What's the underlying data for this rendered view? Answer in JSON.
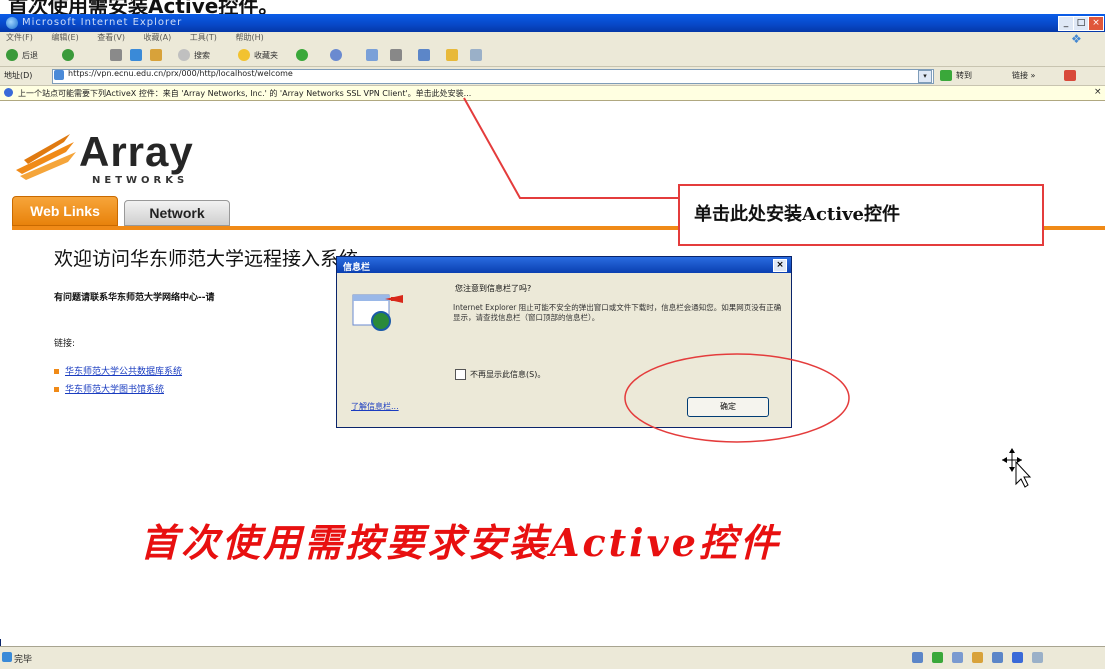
{
  "window": {
    "title": "Microsoft Internet Explorer",
    "buttons": [
      "_",
      "□",
      "×"
    ]
  },
  "address": {
    "label": "地址(D)",
    "url": "https://vpn.ecnu.edu.cn/prx/000/http/localhost/welcome"
  },
  "infobar": {
    "text": "上一个站点可能需要下列ActiveX 控件：来自 'Array Networks, Inc.' 的 'Array Networks SSL VPN Client'。单击此处安装..."
  },
  "logo": {
    "word": "Array",
    "sub": "NETWORKS"
  },
  "tabs": [
    {
      "label": "Web Links"
    },
    {
      "label": "Network"
    }
  ],
  "main": {
    "welcome": "欢迎访问华东师范大学远程接入系统",
    "contact": "有问题请联系华东师范大学网络中心--请",
    "links_label": "链接:",
    "links": [
      "华东师范大学公共数据库系统",
      "华东师范大学图书馆系统"
    ]
  },
  "callout": {
    "text": "单击此处安装Active控件"
  },
  "dialog": {
    "title": "信息栏",
    "question": "您注意到信息栏了吗?",
    "body": "Internet Explorer 阻止可能不安全的弹出窗口或文件下载时，信息栏会通知您。如果网页没有正确显示，请查找信息栏（窗口顶部的信息栏）。",
    "checkbox": "不再显示此信息(S)。",
    "learn_more": "了解信息栏...",
    "ok": "确定",
    "close": "×"
  },
  "banner": {
    "text": "首次使用需按要求安装Active控件"
  },
  "status": {
    "text": "完毕"
  }
}
